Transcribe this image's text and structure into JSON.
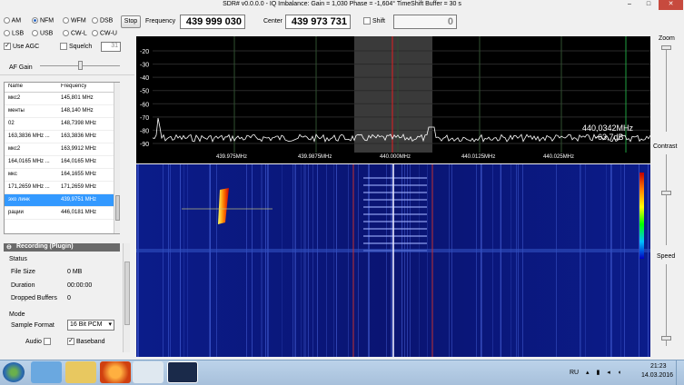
{
  "window": {
    "title": "SDR# v0.0.0.0 - IQ Imbalance: Gain = 1,030 Phase = -1,604° TimeShift Buffer = 30 s"
  },
  "modes": [
    {
      "label": "AM",
      "selected": false
    },
    {
      "label": "NFM",
      "selected": true
    },
    {
      "label": "WFM",
      "selected": false
    },
    {
      "label": "DSB",
      "selected": false
    },
    {
      "label": "LSB",
      "selected": false
    },
    {
      "label": "USB",
      "selected": false
    },
    {
      "label": "CW-L",
      "selected": false
    },
    {
      "label": "CW-U",
      "selected": false
    }
  ],
  "controls": {
    "use_agc_label": "Use AGC",
    "use_agc_checked": true,
    "squelch_label": "Squelch",
    "squelch_checked": false,
    "squelch_value": "31",
    "af_gain_label": "AF Gain"
  },
  "toolbar": {
    "stop_label": "Stop",
    "frequency_label": "Frequency",
    "frequency_value": "439 999 030",
    "center_label": "Center",
    "center_value": "439 973 731",
    "shift_label": "Shift",
    "shift_checked": false,
    "shift_value": "0"
  },
  "frequency_table": {
    "columns": [
      "Name",
      "Frequency"
    ],
    "rows": [
      {
        "name": "мкс2",
        "freq": "145,801 MHz",
        "selected": false
      },
      {
        "name": "менты",
        "freq": "148,140 MHz",
        "selected": false
      },
      {
        "name": "02",
        "freq": "148,7398 MHz",
        "selected": false
      },
      {
        "name": "163,3836 MHz ...",
        "freq": "163,3836 MHz",
        "selected": false
      },
      {
        "name": "мкс2",
        "freq": "163,9912 MHz",
        "selected": false
      },
      {
        "name": "164,0165 MHz ...",
        "freq": "164,0165 MHz",
        "selected": false
      },
      {
        "name": "мкс",
        "freq": "164,1655 MHz",
        "selected": false
      },
      {
        "name": "171,2659 MHz ...",
        "freq": "171,2659 MHz",
        "selected": false
      },
      {
        "name": "эхо линк",
        "freq": "439,9751 MHz",
        "selected": true
      },
      {
        "name": "рации",
        "freq": "446,0181 MHz",
        "selected": false
      }
    ]
  },
  "recording": {
    "header": "Recording (Plugin)",
    "status_label": "Status",
    "file_size_label": "File Size",
    "file_size_value": "0 MB",
    "duration_label": "Duration",
    "duration_value": "00:00:00",
    "dropped_label": "Dropped Buffers",
    "dropped_value": "0",
    "mode_label": "Mode",
    "sample_format_label": "Sample Format",
    "sample_format_value": "16 Bit PCM",
    "audio_label": "Audio",
    "audio_checked": false,
    "baseband_label": "Baseband",
    "baseband_checked": true
  },
  "spectrum": {
    "y_ticks": [
      "-20",
      "-30",
      "-40",
      "-50",
      "-60",
      "-70",
      "-80",
      "-90"
    ],
    "x_ticks": [
      "439.975MHz",
      "439.9875MHz",
      "440.000MHz",
      "440.0125MHz",
      "440.025MHz"
    ],
    "cursor_freq": "440,0342MHz",
    "cursor_level": "-63,7dB"
  },
  "right_panel": {
    "zoom_label": "Zoom",
    "contrast_label": "Contrast",
    "speed_label": "Speed"
  },
  "taskbar": {
    "lang": "RU",
    "time": "21:23",
    "date": "14.03.2016"
  },
  "colors": {
    "selection": "#3399ff",
    "spectrum_trace": "#ffffff",
    "center_marker": "#e02020",
    "waterfall_bg": "#0a0a6a"
  }
}
